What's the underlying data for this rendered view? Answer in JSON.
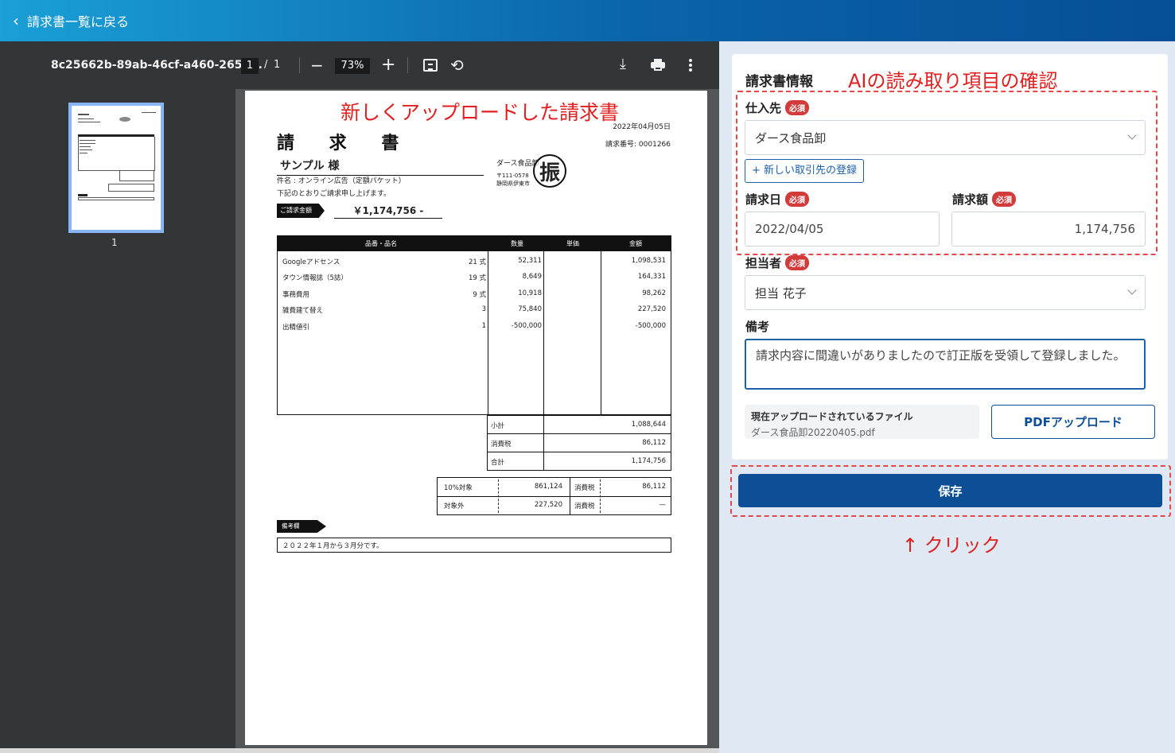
{
  "header": {
    "back_label": "請求書一覧に戻る"
  },
  "viewer": {
    "filename": "8c25662b-89ab-46cf-a460-265e...",
    "page_current": "1",
    "page_sep": "/",
    "page_total": "1",
    "zoom": "73%",
    "thumb_label": "1",
    "icons": [
      "menu-icon",
      "zoom-out-icon",
      "zoom-in-icon",
      "fit-page-icon",
      "rotate-icon",
      "download-icon",
      "print-icon",
      "more-icon"
    ]
  },
  "annotations": {
    "uploaded_note": "新しくアップロードした請求書",
    "ai_check_note": "AIの読み取り項目の確認",
    "click_note": "↑ クリック"
  },
  "invoice": {
    "title": "請 求 書",
    "date": "2022年04月05日",
    "number": "請求番号: 0001266",
    "to": "サンプル 様",
    "subject": "件名 : オンライン広告（定額パケット）",
    "request_note": "下記のとおりご請求申し上げます。",
    "issuer_name": "ダース食品卸",
    "issuer_zip": "〒111-0578",
    "issuer_addr": "静岡県伊東市",
    "stamp": "振",
    "amount_tag": "ご請求金額",
    "amount": "￥1,174,756 -",
    "columns": [
      "品番・品名",
      "数量",
      "単価",
      "金額"
    ],
    "rows": [
      {
        "name": "Googleアドセンス",
        "qty": "21 式",
        "price": "52,311",
        "amount": "1,098,531"
      },
      {
        "name": "タウン情報誌（5誌）",
        "qty": "19 式",
        "price": "8,649",
        "amount": "164,331"
      },
      {
        "name": "事務費用",
        "qty": "9 式",
        "price": "10,918",
        "amount": "98,262"
      },
      {
        "name": "雑費建て替え",
        "qty": "3",
        "price": "75,840",
        "amount": "227,520"
      },
      {
        "name": "出精値引",
        "qty": "1",
        "price": "-500,000",
        "amount": "-500,000"
      }
    ],
    "totals": [
      {
        "label": "小計",
        "value": "1,088,644"
      },
      {
        "label": "消費税",
        "value": "86,112"
      },
      {
        "label": "合計",
        "value": "1,174,756"
      }
    ],
    "tax": [
      {
        "label": "10%対象",
        "base": "861,124",
        "tax_label": "消費税",
        "tax": "86,112"
      },
      {
        "label": "対象外",
        "base": "227,520",
        "tax_label": "消費税",
        "tax": "—"
      }
    ],
    "memo_tag": "備考欄",
    "memo": "２０２２年１月から３月分です。"
  },
  "form": {
    "section_title": "請求書情報",
    "required_badge": "必須",
    "supplier_label": "仕入先",
    "supplier_value": "ダース食品卸",
    "new_partner_button": "+ 新しい取引先の登録",
    "date_label": "請求日",
    "date_value": "2022/04/05",
    "amount_label": "請求額",
    "amount_value": "1,174,756",
    "person_label": "担当者",
    "person_value": "担当 花子",
    "memo_label": "備考",
    "memo_value": "請求内容に間違いがありましたので訂正版を受領して登録しました。",
    "file_title": "現在アップロードされているファイル",
    "file_name": "ダース食品卸20220405.pdf",
    "upload_button": "PDFアップロード",
    "save_button": "保存"
  },
  "colors": {
    "primary": "#0d4f96",
    "required": "#d33b3b",
    "annotation": "#e02020"
  }
}
